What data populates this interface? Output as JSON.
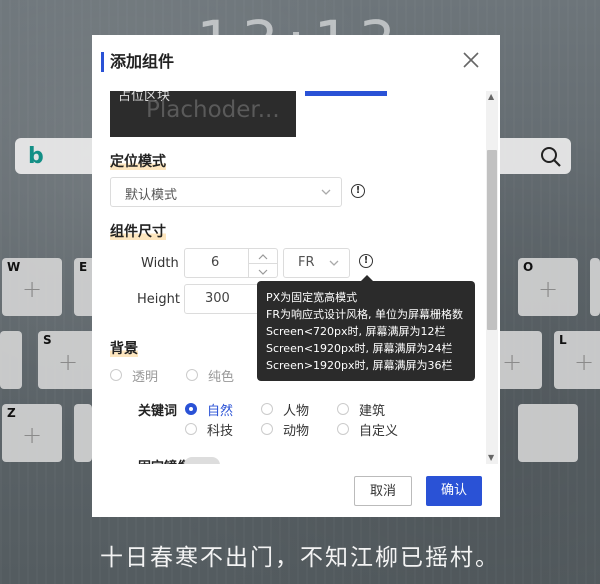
{
  "background": {
    "clock": "13:13",
    "search_logo": "b",
    "poem": "十日春寒不出门，不知江柳已摇村。",
    "keys": [
      {
        "id": "w",
        "letter": "W"
      },
      {
        "id": "e",
        "letter": "E"
      },
      {
        "id": "o",
        "letter": "O"
      },
      {
        "id": "p",
        "letter": ""
      },
      {
        "id": "a",
        "letter": ""
      },
      {
        "id": "s",
        "letter": "S"
      },
      {
        "id": "k",
        "letter": ""
      },
      {
        "id": "l",
        "letter": "L"
      },
      {
        "id": "z",
        "letter": "Z"
      },
      {
        "id": "x",
        "letter": ""
      },
      {
        "id": "m",
        "letter": ""
      }
    ]
  },
  "modal": {
    "title": "添加组件",
    "preview": {
      "line1": "占位区块",
      "line2": "Plachoder..."
    },
    "positioning": {
      "label": "定位模式",
      "value": "默认模式"
    },
    "size": {
      "label": "组件尺寸",
      "width_label": "Width",
      "width_value": "6",
      "width_unit": "FR",
      "height_label": "Height",
      "height_value": "300"
    },
    "tooltip": [
      "PX为固定宽高模式",
      "FR为响应式设计风格, 单位为屏幕栅格数",
      "Screen<720px时, 屏幕满屏为12栏",
      "Screen<1920px时, 屏幕满屏为24栏",
      "Screen>1920px时, 屏幕满屏为36栏"
    ],
    "background": {
      "label": "背景",
      "options": [
        "透明",
        "纯色"
      ],
      "keyword_label": "关键词",
      "keywords": [
        "自然",
        "人物",
        "建筑",
        "科技",
        "动物",
        "自定义"
      ],
      "selected_keyword": "自然",
      "mirror_label": "固定镜像"
    },
    "cancel_label": "取消",
    "ok_label": "确认"
  },
  "colors": {
    "accent": "#2a52d6",
    "tooltip_bg": "#2b2b2b",
    "highlight": "#fde6bf"
  }
}
